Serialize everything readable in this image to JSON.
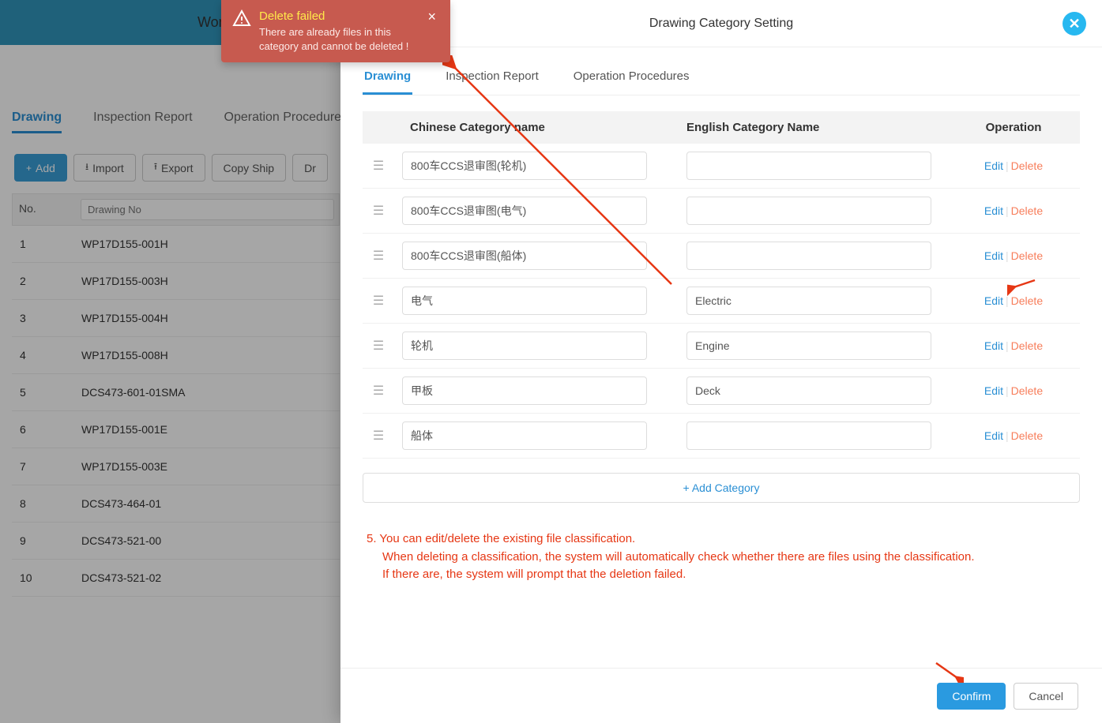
{
  "topBar": {
    "title": "Workbench"
  },
  "bgTabs": [
    {
      "label": "Drawing",
      "active": true
    },
    {
      "label": "Inspection Report",
      "active": false
    },
    {
      "label": "Operation Procedure",
      "active": false
    }
  ],
  "bgToolbar": {
    "add": "Add",
    "import": "Import",
    "export": "Export",
    "copyShip": "Copy Ship",
    "dr": "Dr"
  },
  "bgTableHeader": {
    "no": "No.",
    "drawingNoPlaceholder": "Drawing No"
  },
  "bgRows": [
    {
      "no": "1",
      "dn": "WP17D155-001H"
    },
    {
      "no": "2",
      "dn": "WP17D155-003H"
    },
    {
      "no": "3",
      "dn": "WP17D155-004H"
    },
    {
      "no": "4",
      "dn": "WP17D155-008H"
    },
    {
      "no": "5",
      "dn": "DCS473-601-01SMA"
    },
    {
      "no": "6",
      "dn": "WP17D155-001E"
    },
    {
      "no": "7",
      "dn": "WP17D155-003E"
    },
    {
      "no": "8",
      "dn": "DCS473-464-01"
    },
    {
      "no": "9",
      "dn": "DCS473-521-00"
    },
    {
      "no": "10",
      "dn": "DCS473-521-02"
    }
  ],
  "modal": {
    "title": "Drawing Category Setting",
    "tabs": [
      {
        "label": "Drawing",
        "active": true
      },
      {
        "label": "Inspection Report",
        "active": false
      },
      {
        "label": "Operation Procedures",
        "active": false
      }
    ],
    "headers": {
      "cn": "Chinese Category name",
      "en": "English Category Name",
      "op": "Operation"
    },
    "opLabels": {
      "edit": "Edit",
      "delete": "Delete"
    },
    "rows": [
      {
        "cn": "800车CCS退审图(轮机)",
        "en": ""
      },
      {
        "cn": "800车CCS退审图(电气)",
        "en": ""
      },
      {
        "cn": "800车CCS退审图(船体)",
        "en": ""
      },
      {
        "cn": "电气",
        "en": "Electric"
      },
      {
        "cn": "轮机",
        "en": "Engine"
      },
      {
        "cn": "甲板",
        "en": "Deck"
      },
      {
        "cn": "船体",
        "en": ""
      }
    ],
    "addCategory": "+ Add Category",
    "footer": {
      "confirm": "Confirm",
      "cancel": "Cancel"
    }
  },
  "toast": {
    "title": "Delete failed",
    "text": "There are already files in this category and cannot be deleted !"
  },
  "annotation": {
    "line1": "5. You can edit/delete the existing file classification.",
    "line2": "When deleting a classification, the system will automatically check whether there are files using the classification.",
    "line3": "If there are, the system will prompt that the deletion failed."
  }
}
